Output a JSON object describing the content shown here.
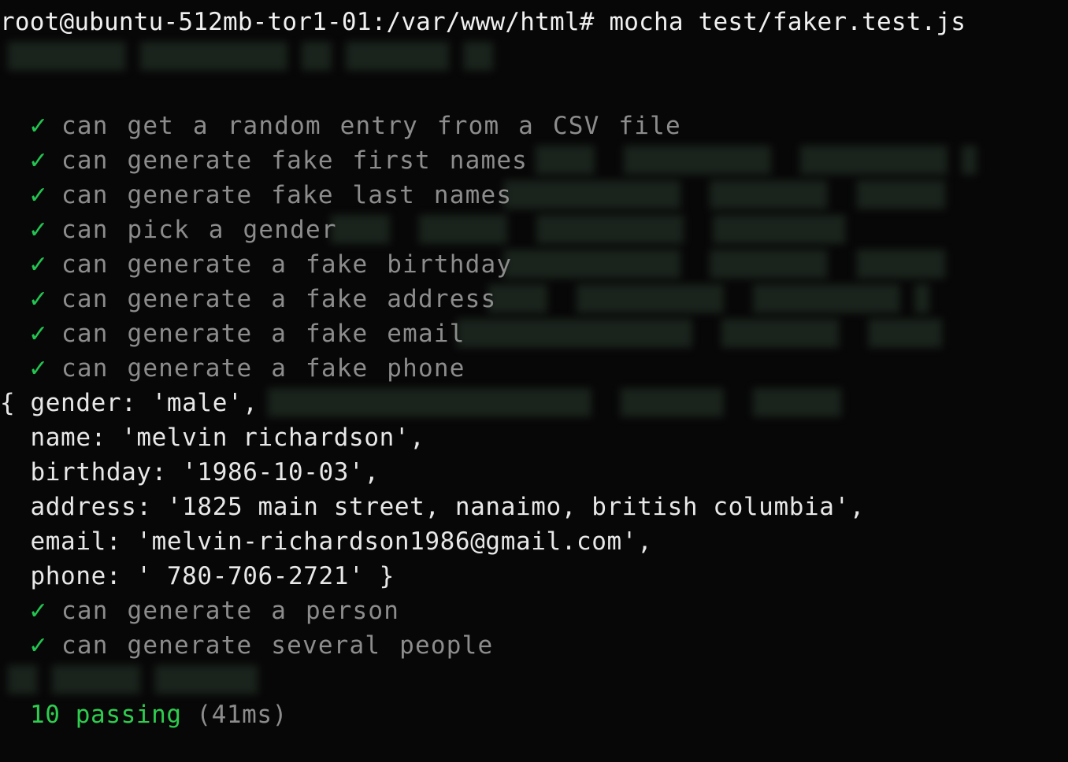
{
  "terminal": {
    "prompt": "root@ubuntu-512mb-tor1-01:/var/www/html#",
    "command": "mocha test/faker.test.js",
    "check_glyph": "✓",
    "tests_before": [
      "can get a random entry from a CSV file",
      "can generate fake first names",
      "can generate fake last names",
      "can pick a gender",
      "can generate a fake birthday",
      "can generate a fake address",
      "can generate a fake email",
      "can generate a fake phone"
    ],
    "output_object": [
      "{ gender: 'male',",
      "  name: 'melvin richardson',",
      "  birthday: '1986-10-03',",
      "  address: '1825 main street, nanaimo, british columbia',",
      "  email: 'melvin-richardson1986@gmail.com',",
      "  phone: ' 780-706-2721' }"
    ],
    "tests_after": [
      "can generate a person",
      "can generate several people"
    ],
    "summary": {
      "passing": "10 passing",
      "duration": "(41ms)"
    }
  },
  "colors": {
    "background": "#070707",
    "check": "#23c552",
    "test_title": "#8c8c8c",
    "text": "#e4e4e4",
    "passing": "#2ecc4f"
  }
}
